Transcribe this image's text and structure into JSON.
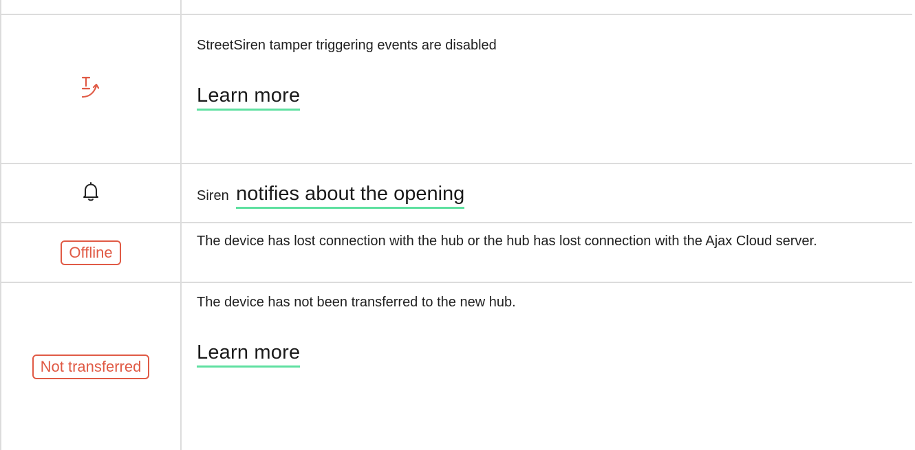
{
  "rows": [
    {
      "id": "tamper",
      "icon": "tamper-disabled-icon",
      "icon_color": "#e05a45",
      "text": "StreetSiren tamper triggering events are disabled",
      "link_label": "Learn more"
    },
    {
      "id": "notify",
      "icon": "bell-icon",
      "prefix": "Siren",
      "link_label": "notifies about the opening"
    },
    {
      "id": "offline",
      "badge": "Offline",
      "text": "The device has lost connection with the hub or the hub has lost connection with the Ajax Cloud server."
    },
    {
      "id": "not-transferred",
      "badge": "Not transferred",
      "text": "The device has not been transferred to the new hub.",
      "link_label": "Learn more"
    }
  ],
  "colors": {
    "badge_red": "#e05a45",
    "link_underline": "#5ee0a0",
    "grid_line": "#dcdcdc"
  }
}
